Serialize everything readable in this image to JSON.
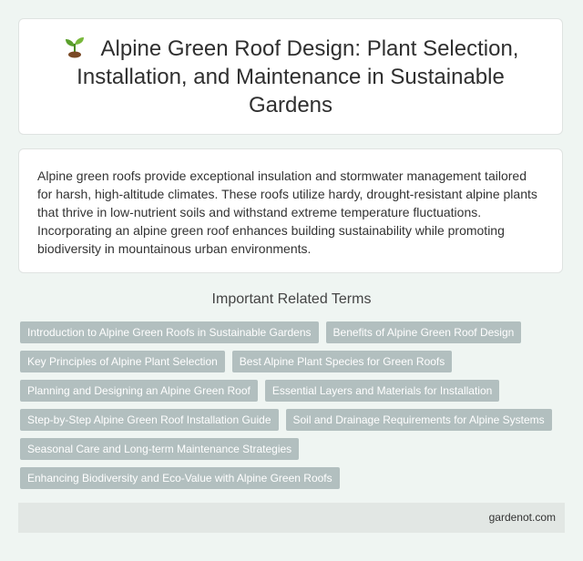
{
  "header": {
    "title": "Alpine Green Roof Design: Plant Selection, Installation, and Maintenance in Sustainable Gardens",
    "icon": "sprout-icon"
  },
  "intro": {
    "text": "Alpine green roofs provide exceptional insulation and stormwater management tailored for harsh, high-altitude climates. These roofs utilize hardy, drought-resistant alpine plants that thrive in low-nutrient soils and withstand extreme temperature fluctuations. Incorporating an alpine green roof enhances building sustainability while promoting biodiversity in mountainous urban environments."
  },
  "related": {
    "heading": "Important Related Terms",
    "terms": [
      "Introduction to Alpine Green Roofs in Sustainable Gardens",
      "Benefits of Alpine Green Roof Design",
      "Key Principles of Alpine Plant Selection",
      "Best Alpine Plant Species for Green Roofs",
      "Planning and Designing an Alpine Green Roof",
      "Essential Layers and Materials for Installation",
      "Step-by-Step Alpine Green Roof Installation Guide",
      "Soil and Drainage Requirements for Alpine Systems",
      "Seasonal Care and Long-term Maintenance Strategies",
      "Enhancing Biodiversity and Eco-Value with Alpine Green Roofs"
    ]
  },
  "footer": {
    "site": "gardenot.com"
  },
  "colors": {
    "background": "#eff5f2",
    "tag": "#b2bfbf",
    "footer": "#e2e7e4"
  }
}
